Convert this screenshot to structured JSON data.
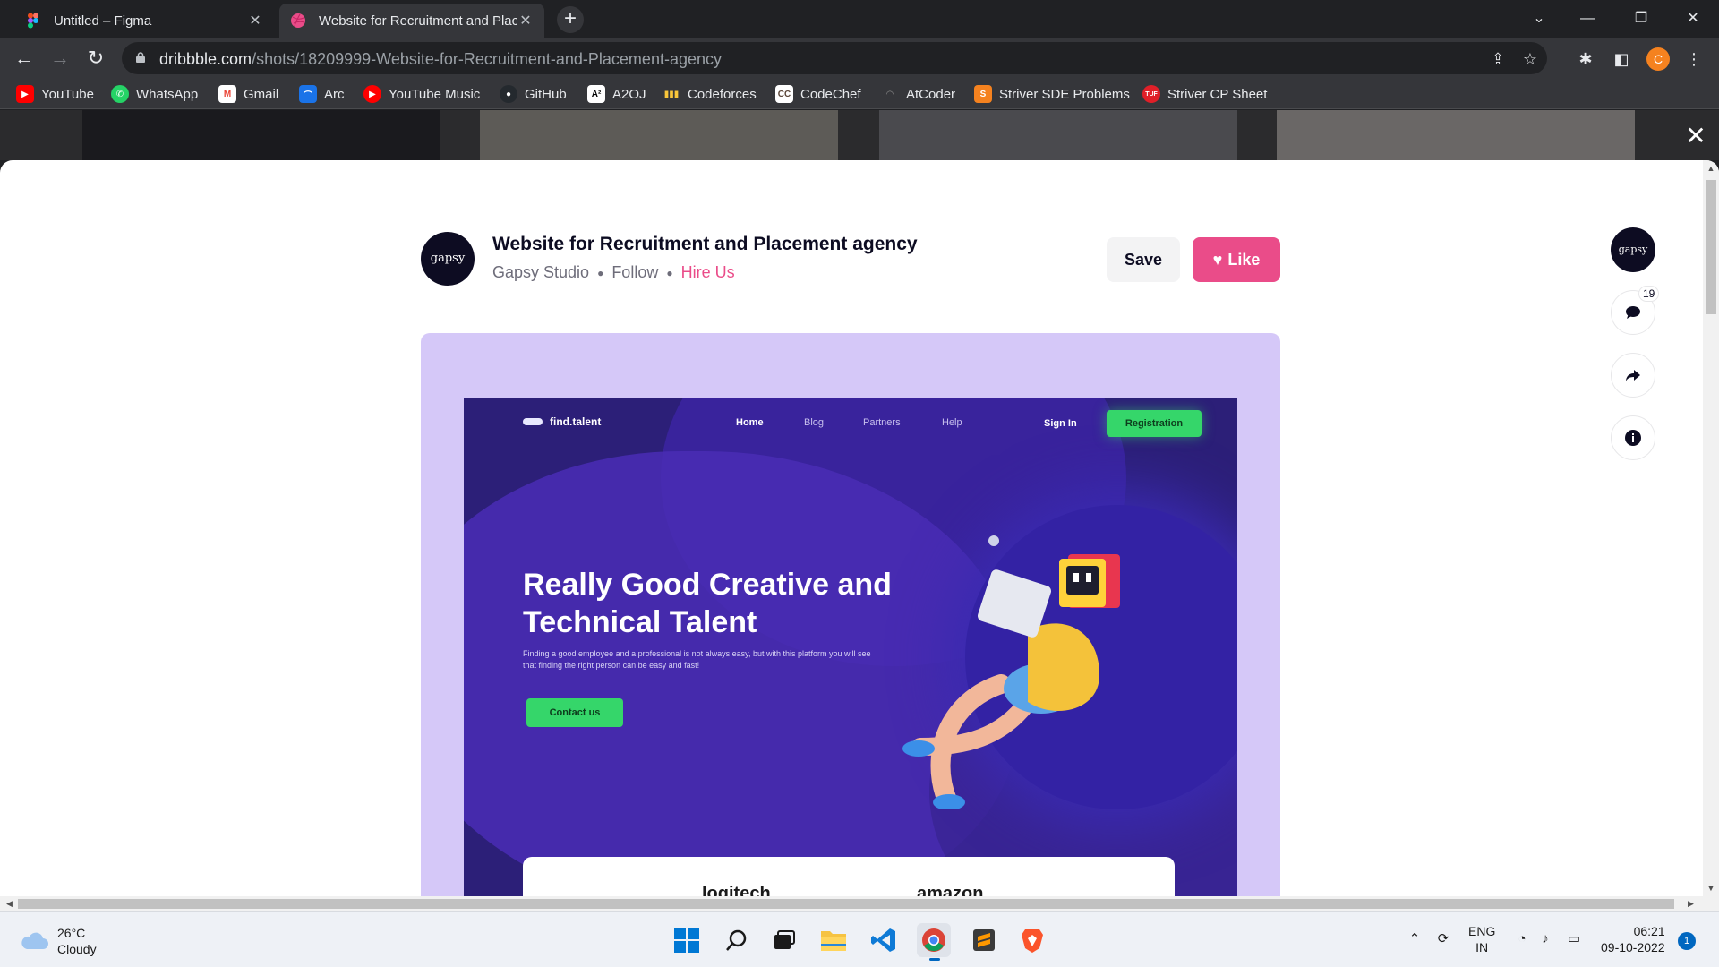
{
  "browser": {
    "tabs": [
      {
        "title": "Untitled – Figma",
        "icon": "figma-icon",
        "active": false
      },
      {
        "title": "Website for Recruitment and Placement agency",
        "icon": "dribbble-icon",
        "active": true
      }
    ],
    "url_host": "dribbble.com",
    "url_path": "/shots/18209999-Website-for-Recruitment-and-Placement-agency",
    "profile_initial": "C"
  },
  "bookmarks": [
    {
      "label": "YouTube",
      "icon": "youtube-icon",
      "color": "#ff0000"
    },
    {
      "label": "WhatsApp",
      "icon": "whatsapp-icon",
      "color": "#25d366"
    },
    {
      "label": "Gmail",
      "icon": "gmail-icon",
      "color": "#ea4335"
    },
    {
      "label": "Arc",
      "icon": "arc-icon",
      "color": "#1a73e8"
    },
    {
      "label": "YouTube Music",
      "icon": "youtube-music-icon",
      "color": "#ff0000"
    },
    {
      "label": "GitHub",
      "icon": "github-icon",
      "color": "#24292e"
    },
    {
      "label": "A2OJ",
      "icon": "a2oj-icon",
      "color": "#000000"
    },
    {
      "label": "Codeforces",
      "icon": "codeforces-icon",
      "color": "#1f8acb"
    },
    {
      "label": "CodeChef",
      "icon": "codechef-icon",
      "color": "#5b4638"
    },
    {
      "label": "AtCoder",
      "icon": "atcoder-icon",
      "color": "#555555"
    },
    {
      "label": "Striver SDE Problems",
      "icon": "striver-icon",
      "color": "#f5821f"
    },
    {
      "label": "Striver CP Sheet",
      "icon": "tuf-icon",
      "color": "#e01f28"
    }
  ],
  "shot": {
    "title": "Website for Recruitment and Placement agency",
    "author": "Gapsy Studio",
    "follow_label": "Follow",
    "hire_label": "Hire Us",
    "avatar_text": "gapsy",
    "save_label": "Save",
    "like_label": "Like",
    "comment_count": "19",
    "accent_color": "#ea4c89"
  },
  "mockup": {
    "logo": "find.talent",
    "nav": [
      "Home",
      "Blog",
      "Partners",
      "Help"
    ],
    "signin": "Sign In",
    "register": "Registration",
    "hero": "Really Good Creative and Technical Talent",
    "subtitle": "Finding a good employee and a professional is not always easy, but with this platform you will see that finding the right person can be easy and fast!",
    "cta": "Contact us",
    "brands": [
      "logitech",
      "amazon"
    ]
  },
  "taskbar": {
    "temperature": "26°C",
    "weather": "Cloudy",
    "lang": "ENG",
    "region": "IN",
    "time": "06:21",
    "date": "09-10-2022",
    "notifications": "1"
  }
}
